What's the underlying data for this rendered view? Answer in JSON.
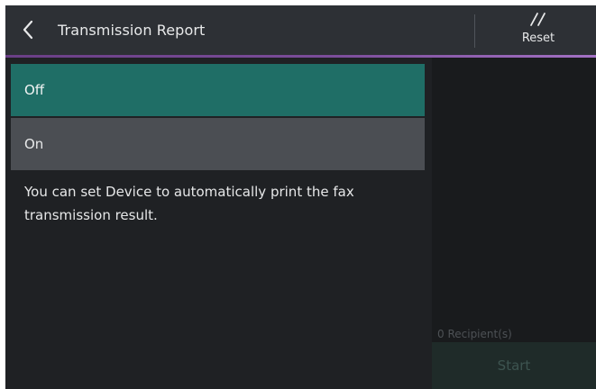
{
  "header": {
    "title": "Transmission Report",
    "back_icon": "chevron-left-icon",
    "reset_icon": "double-slash-icon",
    "reset_label": "Reset",
    "accent_line_color": "#7b4d9a"
  },
  "options": [
    {
      "label": "Off",
      "selected": true,
      "color": "#1f6e66"
    },
    {
      "label": "On",
      "selected": false,
      "color": "#4b4e53"
    }
  ],
  "description": "You can set Device to automatically print the fax transmission result.",
  "side_panel": {
    "recipients": "0 Recipient(s)",
    "start_label": "Start",
    "start_enabled": false
  }
}
